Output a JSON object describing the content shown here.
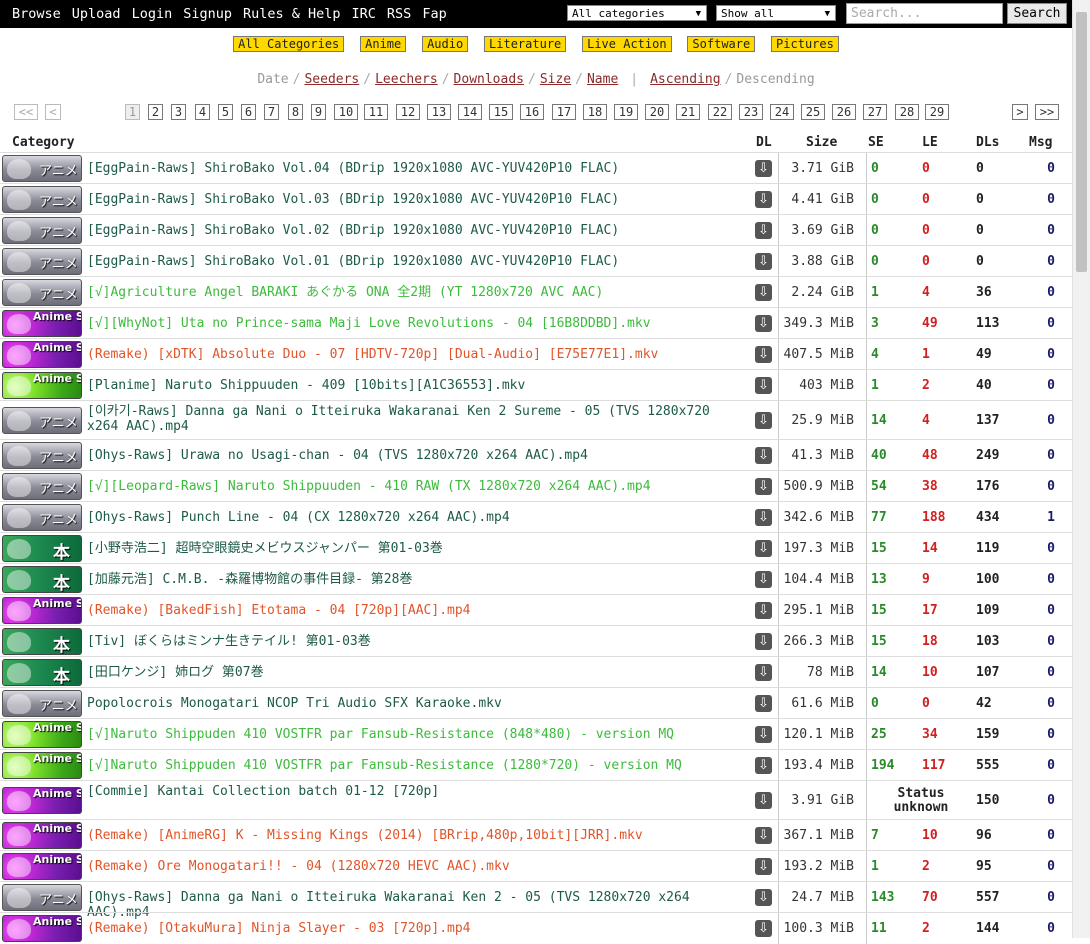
{
  "nav": {
    "items": [
      "Browse",
      "Upload",
      "Login",
      "Signup",
      "Rules & Help",
      "IRC",
      "RSS",
      "Fap"
    ]
  },
  "filters": {
    "category": "All categories",
    "show": "Show all"
  },
  "search": {
    "placeholder": "Search...",
    "button": "Search"
  },
  "categories": [
    "All Categories",
    "Anime",
    "Audio",
    "Literature",
    "Live Action",
    "Software",
    "Pictures"
  ],
  "sort": {
    "fields": [
      "Date",
      "Seeders",
      "Leechers",
      "Downloads",
      "Size",
      "Name"
    ],
    "orders": [
      "Ascending",
      "Descending"
    ]
  },
  "pagination": {
    "prev": [
      "<<",
      "<"
    ],
    "pages": [
      "1",
      "2",
      "3",
      "4",
      "5",
      "6",
      "7",
      "8",
      "9",
      "10",
      "11",
      "12",
      "13",
      "14",
      "15",
      "16",
      "17",
      "18",
      "19",
      "20",
      "21",
      "22",
      "23",
      "24",
      "25",
      "26",
      "27",
      "28",
      "29"
    ],
    "next": [
      ">",
      ">>"
    ]
  },
  "table": {
    "headers": {
      "category": "Category",
      "dl": "DL",
      "size": "Size",
      "se": "SE",
      "le": "LE",
      "dls": "DLs",
      "msg": "Msg"
    },
    "rows": [
      {
        "cat": "anime",
        "cat_label": "アニメ",
        "name": "[EggPain-Raws] ShiroBako Vol.04 (BDrip 1920x1080 AVC-YUV420P10 FLAC)",
        "color": "dark",
        "size": "3.71 GiB",
        "se": "0",
        "le": "0",
        "dls": "0",
        "msg": "0"
      },
      {
        "cat": "anime",
        "cat_label": "アニメ",
        "name": "[EggPain-Raws] ShiroBako Vol.03 (BDrip 1920x1080 AVC-YUV420P10 FLAC)",
        "color": "dark",
        "size": "4.41 GiB",
        "se": "0",
        "le": "0",
        "dls": "0",
        "msg": "0"
      },
      {
        "cat": "anime",
        "cat_label": "アニメ",
        "name": "[EggPain-Raws] ShiroBako Vol.02 (BDrip 1920x1080 AVC-YUV420P10 FLAC)",
        "color": "dark",
        "size": "3.69 GiB",
        "se": "0",
        "le": "0",
        "dls": "0",
        "msg": "0"
      },
      {
        "cat": "anime",
        "cat_label": "アニメ",
        "name": "[EggPain-Raws] ShiroBako Vol.01 (BDrip 1920x1080 AVC-YUV420P10 FLAC)",
        "color": "dark",
        "size": "3.88 GiB",
        "se": "0",
        "le": "0",
        "dls": "0",
        "msg": "0"
      },
      {
        "cat": "anime",
        "cat_label": "アニメ",
        "name": "[√]Agriculture Angel BARAKI あぐかる ONA 全2期 (YT 1280x720 AVC AAC)",
        "color": "lime",
        "size": "2.24 GiB",
        "se": "1",
        "le": "4",
        "dls": "36",
        "msg": "0"
      },
      {
        "cat": "animesub-p",
        "cat_label": "Anime Sub",
        "name": "[√][WhyNot] Uta no Prince-sama Maji Love Revolutions - 04 [16B8DDBD].mkv",
        "color": "lime",
        "size": "349.3 MiB",
        "se": "3",
        "le": "49",
        "dls": "113",
        "msg": "0"
      },
      {
        "cat": "animesub-p",
        "cat_label": "Anime Sub",
        "name": "(Remake) [xDTK] Absolute Duo - 07 [HDTV-720p] [Dual-Audio] [E75E77E1].mkv",
        "color": "red",
        "size": "407.5 MiB",
        "se": "4",
        "le": "1",
        "dls": "49",
        "msg": "0"
      },
      {
        "cat": "animesub-g",
        "cat_label": "Anime Sub",
        "name": "[Planime] Naruto Shippuuden - 409 [10bits][A1C36553].mkv",
        "color": "dark",
        "size": "403 MiB",
        "se": "1",
        "le": "2",
        "dls": "40",
        "msg": "0"
      },
      {
        "cat": "anime",
        "cat_label": "アニメ",
        "name": "[이카기-Raws] Danna ga Nani o Itteiruka Wakaranai Ken 2 Sureme - 05 (TVS 1280x720 x264 AAC).mp4",
        "color": "dark",
        "size": "25.9 MiB",
        "se": "14",
        "le": "4",
        "dls": "137",
        "msg": "0"
      },
      {
        "cat": "anime",
        "cat_label": "アニメ",
        "name": "[Ohys-Raws] Urawa no Usagi-chan - 04 (TVS 1280x720 x264 AAC).mp4",
        "color": "dark",
        "size": "41.3 MiB",
        "se": "40",
        "le": "48",
        "dls": "249",
        "msg": "0"
      },
      {
        "cat": "anime",
        "cat_label": "アニメ",
        "name": "[√][Leopard-Raws] Naruto Shippuuden - 410 RAW (TX 1280x720 x264 AAC).mp4",
        "color": "lime",
        "size": "500.9 MiB",
        "se": "54",
        "le": "38",
        "dls": "176",
        "msg": "0"
      },
      {
        "cat": "anime",
        "cat_label": "アニメ",
        "name": "[Ohys-Raws] Punch Line - 04 (CX 1280x720 x264 AAC).mp4",
        "color": "dark",
        "size": "342.6 MiB",
        "se": "77",
        "le": "188",
        "dls": "434",
        "msg": "1"
      },
      {
        "cat": "book",
        "cat_label": "本",
        "name": "[小野寺浩二] 超時空眼鏡史メビウスジャンパー 第01-03巻",
        "color": "dark",
        "size": "197.3 MiB",
        "se": "15",
        "le": "14",
        "dls": "119",
        "msg": "0"
      },
      {
        "cat": "book",
        "cat_label": "本",
        "name": "[加藤元浩] C.M.B. -森羅博物館の事件目録- 第28巻",
        "color": "dark",
        "size": "104.4 MiB",
        "se": "13",
        "le": "9",
        "dls": "100",
        "msg": "0"
      },
      {
        "cat": "animesub-p",
        "cat_label": "Anime Sub",
        "name": "(Remake) [BakedFish] Etotama - 04 [720p][AAC].mp4",
        "color": "red",
        "size": "295.1 MiB",
        "se": "15",
        "le": "17",
        "dls": "109",
        "msg": "0"
      },
      {
        "cat": "book",
        "cat_label": "本",
        "name": "[Tiv] ぼくらはミンナ生きテイル! 第01-03巻",
        "color": "dark",
        "size": "266.3 MiB",
        "se": "15",
        "le": "18",
        "dls": "103",
        "msg": "0"
      },
      {
        "cat": "book",
        "cat_label": "本",
        "name": "[田口ケンジ] 姉ログ 第07巻",
        "color": "dark",
        "size": "78 MiB",
        "se": "14",
        "le": "10",
        "dls": "107",
        "msg": "0"
      },
      {
        "cat": "anime",
        "cat_label": "アニメ",
        "name": "Popolocrois Monogatari NCOP Tri Audio SFX Karaoke.mkv",
        "color": "dark",
        "size": "61.6 MiB",
        "se": "0",
        "le": "0",
        "dls": "42",
        "msg": "0"
      },
      {
        "cat": "animesub-g",
        "cat_label": "Anime Sub",
        "name": "[√]Naruto Shippuden 410 VOSTFR par Fansub-Resistance (848*480) - version MQ",
        "color": "lime",
        "size": "120.1 MiB",
        "se": "25",
        "le": "34",
        "dls": "159",
        "msg": "0"
      },
      {
        "cat": "animesub-g",
        "cat_label": "Anime Sub",
        "name": "[√]Naruto Shippuden 410 VOSTFR par Fansub-Resistance (1280*720) - version MQ",
        "color": "lime",
        "size": "193.4 MiB",
        "se": "194",
        "le": "117",
        "dls": "555",
        "msg": "0"
      },
      {
        "cat": "animesub-p",
        "cat_label": "Anime Sub",
        "name": "[Commie] Kantai Collection batch 01-12 [720p]",
        "color": "dark",
        "size": "3.91 GiB",
        "status": "Status unknown",
        "dls": "150",
        "msg": "0"
      },
      {
        "cat": "animesub-p",
        "cat_label": "Anime Sub",
        "name": "(Remake) [AnimeRG] K - Missing Kings (2014) [BRrip,480p,10bit][JRR].mkv",
        "color": "red",
        "size": "367.1 MiB",
        "se": "7",
        "le": "10",
        "dls": "96",
        "msg": "0"
      },
      {
        "cat": "animesub-p",
        "cat_label": "Anime Sub",
        "name": "(Remake) Ore Monogatari!! - 04 (1280x720 HEVC AAC).mkv",
        "color": "red",
        "size": "193.2 MiB",
        "se": "1",
        "le": "2",
        "dls": "95",
        "msg": "0"
      },
      {
        "cat": "anime",
        "cat_label": "アニメ",
        "name": "[Ohys-Raws] Danna ga Nani o Itteiruka Wakaranai Ken 2 - 05 (TVS 1280x720 x264 AAC).mp4",
        "color": "dark",
        "size": "24.7 MiB",
        "se": "143",
        "le": "70",
        "dls": "557",
        "msg": "0"
      },
      {
        "cat": "animesub-p",
        "cat_label": "Anime Sub",
        "name": "(Remake) [OtakuMura] Ninja Slayer - 03 [720p].mp4",
        "color": "red",
        "size": "100.3 MiB",
        "se": "11",
        "le": "2",
        "dls": "144",
        "msg": "0"
      }
    ]
  }
}
